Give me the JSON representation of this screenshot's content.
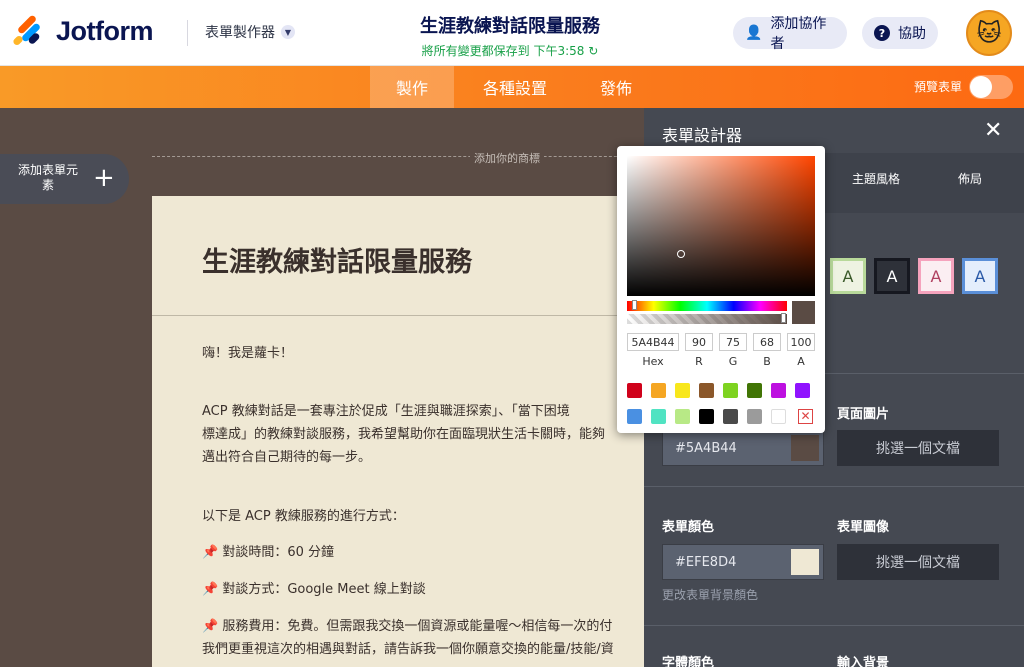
{
  "header": {
    "logo_text": "Jotform",
    "builder_label": "表單製作器",
    "form_title": "生涯教練對話限量服務",
    "saved_status": "將所有變更都保存到 下午3:58",
    "add_collaborator": "添加協作者",
    "help": "協助"
  },
  "nav": {
    "tabs": [
      "製作",
      "各種設置",
      "發佈"
    ],
    "active_tab": "製作",
    "preview_label": "預覽表單"
  },
  "sidebar": {
    "add_element": "添加表單元素"
  },
  "canvas": {
    "logo_placeholder": "添加你的商標",
    "title": "生涯教練對話限量服務",
    "paragraphs": [
      "嗨！我是蘿卡！",
      "ACP 教練對話是一套專注於促成「生涯與職涯探索」、「當下困境",
      "標達成」的教練對談服務，我希望幫助你在面臨現狀生活卡關時，能夠",
      "邁出符合自己期待的每一步。",
      "以下是 ACP 教練服務的進行方式：",
      "📌 對談時間：60 分鐘",
      "📌 對談方式：Google Meet 線上對談",
      "📌 服務費用：免費。但需跟我交換一個資源或能量喔～相信每一次的付",
      "我們更重視這次的相遇與對話，請告訴我一個你願意交換的能量/技能/資"
    ]
  },
  "designer": {
    "title": "表單設計器",
    "tabs": [
      "主題風格",
      "佈局"
    ],
    "swatch_letter": "A",
    "page_color": {
      "value": "#5A4B44",
      "swatch": "#5a4b44"
    },
    "page_image": {
      "label": "頁面圖片",
      "button": "挑選一個文檔"
    },
    "form_color": {
      "label": "表單顏色",
      "value": "#EFE8D4",
      "swatch": "#efe8d4",
      "hint": "更改表單背景顏色"
    },
    "form_image": {
      "label": "表單圖像",
      "button": "挑選一個文檔"
    },
    "font_color_label": "字體顏色",
    "input_bg_label": "輸入背景"
  },
  "picker": {
    "hex": "5A4B44",
    "r": "90",
    "g": "75",
    "b": "68",
    "a": "100",
    "labels": [
      "Hex",
      "R",
      "G",
      "B",
      "A"
    ],
    "presets": [
      "#d0021b",
      "#f5a623",
      "#f8e71c",
      "#8b572a",
      "#7ed321",
      "#417505",
      "#bd10e0",
      "#9013fe",
      "#4a90e2",
      "#50e3c2",
      "#b8e986",
      "#000000",
      "#4a4a4a",
      "#9b9b9b",
      "#ffffff"
    ]
  },
  "colors": {
    "accent": "#fa7a1c",
    "brand_navy": "#0a1551",
    "saved_green": "#18a048"
  }
}
